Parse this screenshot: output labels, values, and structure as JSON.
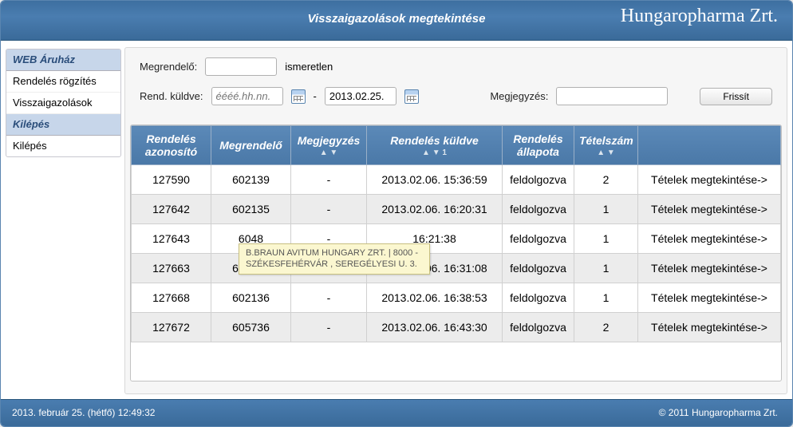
{
  "header": {
    "page_title": "Visszaigazolások megtekintése",
    "brand": "Hungaropharma Zrt."
  },
  "sidebar": {
    "items": [
      {
        "label": "WEB Áruház",
        "header": true
      },
      {
        "label": "Rendelés rögzítés",
        "header": false
      },
      {
        "label": "Visszaigazolások",
        "header": false
      },
      {
        "label": "Kilépés",
        "header": true
      },
      {
        "label": "Kilépés",
        "header": false
      }
    ]
  },
  "filter": {
    "megrendelo_label": "Megrendelő:",
    "megrendelo_value": "",
    "megrendelo_status": "ismeretlen",
    "rendkuldve_label": "Rend. küldve:",
    "date_from_placeholder": "éééé.hh.nn.",
    "date_from_value": "",
    "date_sep": "-",
    "date_to_value": "2013.02.25.",
    "megjegyzes_label": "Megjegyzés:",
    "megjegyzes_value": "",
    "refresh_label": "Frissít"
  },
  "table": {
    "headers": {
      "rendeles_azonosito": "Rendelés azonosító",
      "megrendelo": "Megrendelő",
      "megjegyzes": "Megjegyzés",
      "rendeles_kuldve": "Rendelés küldve",
      "rendeles_allapota": "Rendelés állapota",
      "tetelszam": "Tételszám",
      "view": ""
    },
    "sort_indicator_1": "▲ ▼ 1",
    "sort_indicator_plain": "▲ ▼",
    "view_label": "Tételek megtekintése->",
    "rows": [
      {
        "rendeles_azonosito": "127590",
        "megrendelo": "602139",
        "megjegyzes": "-",
        "rendeles_kuldve": "2013.02.06. 15:36:59",
        "rendeles_allapota": "feldolgozva",
        "tetelszam": "2"
      },
      {
        "rendeles_azonosito": "127642",
        "megrendelo": "602135",
        "megjegyzes": "-",
        "rendeles_kuldve": "2013.02.06. 16:20:31",
        "rendeles_allapota": "feldolgozva",
        "tetelszam": "1"
      },
      {
        "rendeles_azonosito": "127643",
        "megrendelo": "6048",
        "megjegyzes": "-",
        "rendeles_kuldve": "16:21:38",
        "rendeles_allapota": "feldolgozva",
        "tetelszam": "1"
      },
      {
        "rendeles_azonosito": "127663",
        "megrendelo": "602135",
        "megjegyzes": "-",
        "rendeles_kuldve": "2013.02.06. 16:31:08",
        "rendeles_allapota": "feldolgozva",
        "tetelszam": "1"
      },
      {
        "rendeles_azonosito": "127668",
        "megrendelo": "602136",
        "megjegyzes": "-",
        "rendeles_kuldve": "2013.02.06. 16:38:53",
        "rendeles_allapota": "feldolgozva",
        "tetelszam": "1"
      },
      {
        "rendeles_azonosito": "127672",
        "megrendelo": "605736",
        "megjegyzes": "-",
        "rendeles_kuldve": "2013.02.06. 16:43:30",
        "rendeles_allapota": "feldolgozva",
        "tetelszam": "2"
      }
    ]
  },
  "tooltip": {
    "text": "B.BRAUN AVITUM HUNGARY ZRT. | 8000 - SZÉKESFEHÉRVÁR , SEREGÉLYESI U. 3."
  },
  "footer": {
    "left": "2013. február 25. (hétfő) 12:49:32",
    "right": "© 2011 Hungaropharma Zrt."
  }
}
